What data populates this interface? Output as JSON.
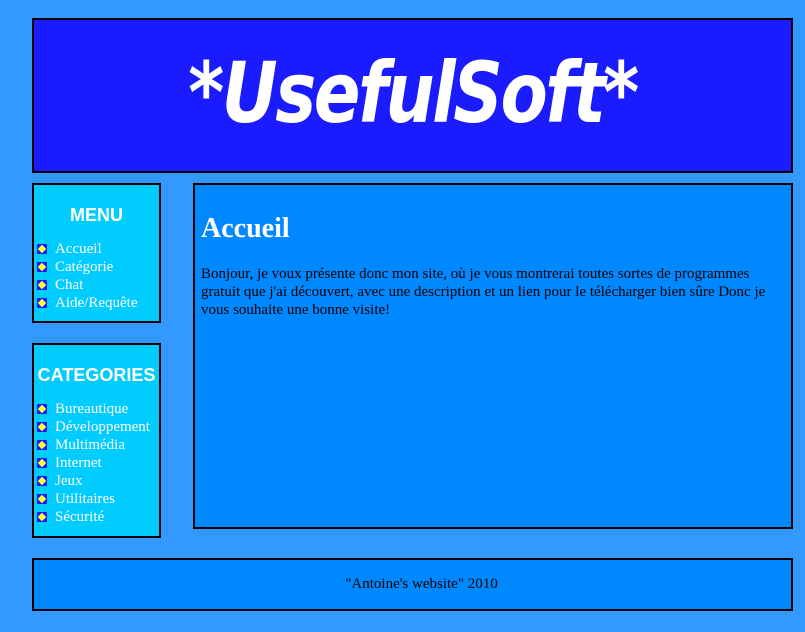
{
  "banner": {
    "logo_text": "*UsefulSoft*"
  },
  "menu": {
    "title": "MENU",
    "items": [
      {
        "label": "Accueil"
      },
      {
        "label": "Catégorie"
      },
      {
        "label": "Chat"
      },
      {
        "label": "Aide/Requête"
      }
    ]
  },
  "categories": {
    "title": "CATEGORIES",
    "items": [
      {
        "label": "Bureautique"
      },
      {
        "label": "Développement"
      },
      {
        "label": "Multimédia"
      },
      {
        "label": "Internet"
      },
      {
        "label": "Jeux"
      },
      {
        "label": "Utilitaires"
      },
      {
        "label": "Sécurité"
      }
    ]
  },
  "content": {
    "heading": "Accueil",
    "paragraph": "Bonjour, je voux présente donc mon site, où je vous montrerai toutes sortes de programmes gratuit que j'ai découvert, avec une description et un lien pour le télécharger bien sûre Donc je vous souhaite une bonne visite!"
  },
  "footer": {
    "text": "\"Antoine's website\" 2010"
  },
  "colors": {
    "page_background": "#3399ff",
    "banner_background": "#1b1bff",
    "menu_background": "#00ccff",
    "content_background": "#0088ff",
    "bullet_fill": "#ffff33"
  }
}
